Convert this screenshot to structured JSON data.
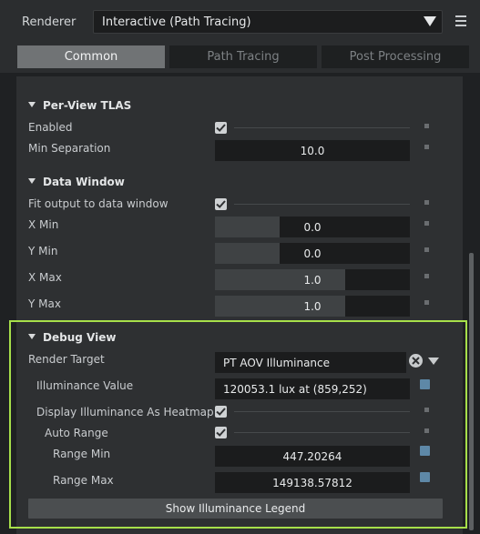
{
  "header": {
    "renderer_label": "Renderer",
    "renderer_value": "Interactive (Path Tracing)"
  },
  "tabs": [
    {
      "label": "Common",
      "active": true
    },
    {
      "label": "Path Tracing",
      "active": false
    },
    {
      "label": "Post Processing",
      "active": false
    }
  ],
  "per_view_tlas": {
    "title": "Per-View TLAS",
    "enabled_label": "Enabled",
    "enabled": true,
    "min_separation_label": "Min Separation",
    "min_separation_value": "10.0"
  },
  "data_window": {
    "title": "Data Window",
    "fit_label": "Fit output to data window",
    "fit_checked": true,
    "x_min_label": "X Min",
    "x_min_value": "0.0",
    "y_min_label": "Y Min",
    "y_min_value": "0.0",
    "x_max_label": "X Max",
    "x_max_value": "1.0",
    "y_max_label": "Y Max",
    "y_max_value": "1.0"
  },
  "debug_view": {
    "title": "Debug View",
    "render_target_label": "Render Target",
    "render_target_value": "PT AOV Illuminance",
    "illuminance_value_label": "Illuminance Value",
    "illuminance_value": "120053.1 lux at (859,252)",
    "display_heatmap_label": "Display Illuminance As Heatmap",
    "display_heatmap_checked": true,
    "auto_range_label": "Auto Range",
    "auto_range_checked": true,
    "range_min_label": "Range Min",
    "range_min_value": "447.20264",
    "range_max_label": "Range Max",
    "range_max_value": "149138.57812",
    "legend_button": "Show Illuminance Legend"
  },
  "colors": {
    "highlight_border": "#a7e04a",
    "accent_square": "#5e88a7"
  }
}
